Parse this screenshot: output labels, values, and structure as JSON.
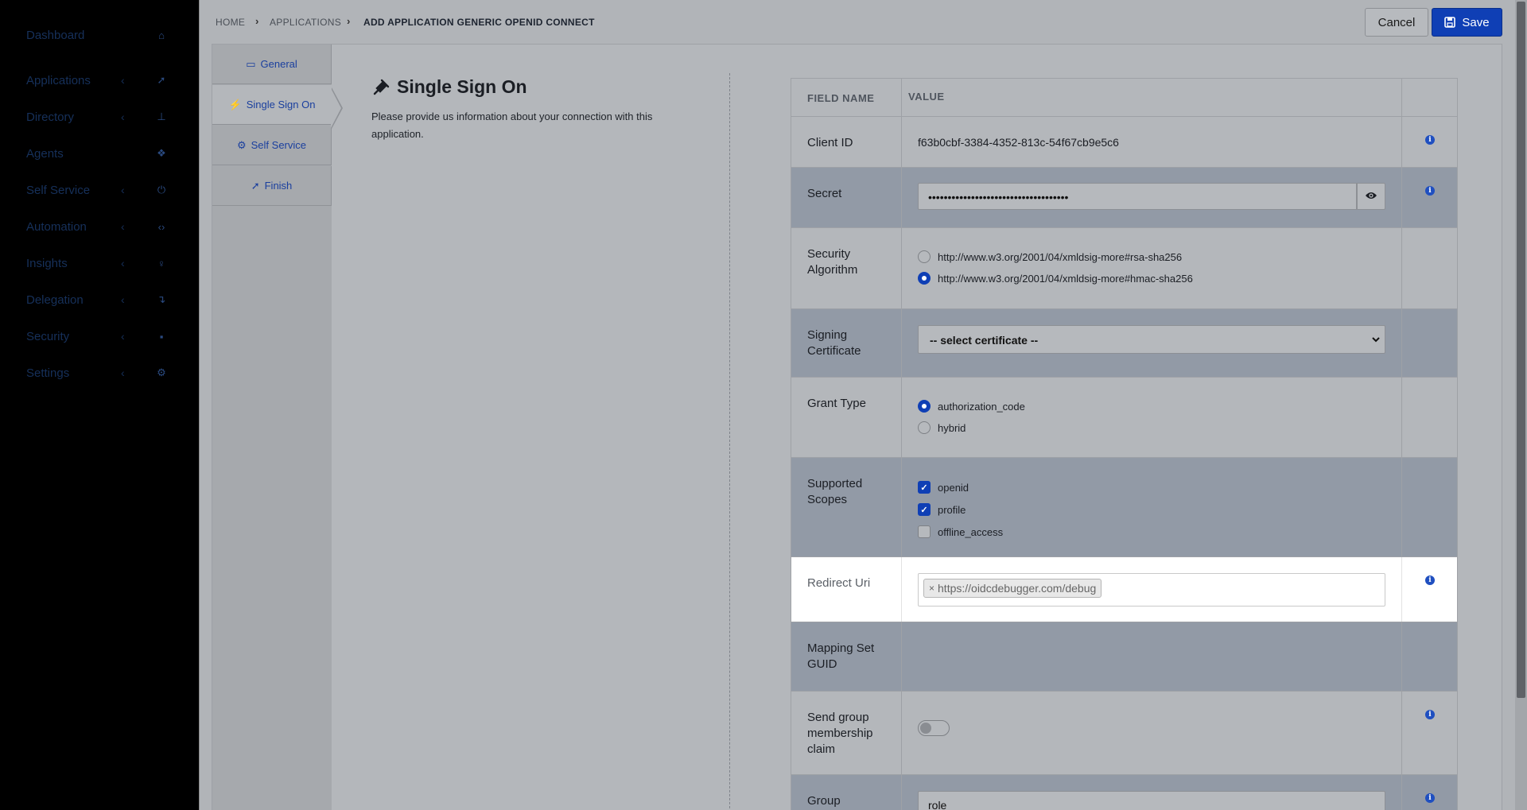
{
  "sidebar": {
    "items": [
      {
        "label": "Dashboard",
        "chevron": "",
        "icon": "home-icon",
        "glyph": "⌂"
      },
      {
        "label": "Applications",
        "chevron": "‹",
        "icon": "rocket-icon",
        "glyph": "➚"
      },
      {
        "label": "Directory",
        "chevron": "‹",
        "icon": "sitemap-icon",
        "glyph": "⊥"
      },
      {
        "label": "Agents",
        "chevron": "",
        "icon": "cubes-icon",
        "glyph": "❖"
      },
      {
        "label": "Self Service",
        "chevron": "‹",
        "icon": "power-icon",
        "glyph": "⏻"
      },
      {
        "label": "Automation",
        "chevron": "‹",
        "icon": "code-icon",
        "glyph": "‹›"
      },
      {
        "label": "Insights",
        "chevron": "‹",
        "icon": "lightbulb-icon",
        "glyph": "♀"
      },
      {
        "label": "Delegation",
        "chevron": "‹",
        "icon": "level-icon",
        "glyph": "↴"
      },
      {
        "label": "Security",
        "chevron": "‹",
        "icon": "lock-icon",
        "glyph": "▪"
      },
      {
        "label": "Settings",
        "chevron": "‹",
        "icon": "gear-icon",
        "glyph": "⚙"
      }
    ]
  },
  "breadcrumb": {
    "home": "HOME",
    "applications": "APPLICATIONS",
    "current": "ADD APPLICATION GENERIC OPENID CONNECT",
    "sep": "›"
  },
  "toolbar": {
    "cancel_label": "Cancel",
    "save_label": "Save"
  },
  "tabs": [
    {
      "label": "General",
      "icon": "desktop-icon",
      "glyph": "▭"
    },
    {
      "label": "Single Sign On",
      "icon": "plug-icon",
      "glyph": "⚡"
    },
    {
      "label": "Self Service",
      "icon": "cogs-icon",
      "glyph": "⚙"
    },
    {
      "label": "Finish",
      "icon": "rocket-icon",
      "glyph": "➚"
    }
  ],
  "section": {
    "title": "Single Sign On",
    "description": "Please provide us information about your connection with this application."
  },
  "table": {
    "header_field": "FIELD NAME",
    "header_value": "VALUE",
    "client_id": {
      "label": "Client ID",
      "value": "f63b0cbf-3384-4352-813c-54f67cb9e5c6"
    },
    "secret": {
      "label": "Secret",
      "value": "••••••••••••••••••••••••••••••••••••"
    },
    "security_algorithm": {
      "label": "Security Algorithm",
      "options": [
        {
          "label": "http://www.w3.org/2001/04/xmldsig-more#rsa-sha256",
          "selected": false
        },
        {
          "label": "http://www.w3.org/2001/04/xmldsig-more#hmac-sha256",
          "selected": true
        }
      ]
    },
    "signing_certificate": {
      "label": "Signing Certificate",
      "selected": "-- select certificate --"
    },
    "grant_type": {
      "label": "Grant Type",
      "options": [
        {
          "label": "authorization_code",
          "selected": true
        },
        {
          "label": "hybrid",
          "selected": false
        }
      ]
    },
    "supported_scopes": {
      "label": "Supported Scopes",
      "options": [
        {
          "label": "openid",
          "checked": true
        },
        {
          "label": "profile",
          "checked": true
        },
        {
          "label": "offline_access",
          "checked": false
        }
      ]
    },
    "redirect_uri": {
      "label": "Redirect Uri",
      "tag": "https://oidcdebugger.com/debug",
      "remove": "×"
    },
    "mapping_set_guid": {
      "label": "Mapping Set GUID"
    },
    "send_group_claim": {
      "label": "Send group membership claim",
      "enabled": false
    },
    "group": {
      "label": "Group",
      "value": "role"
    }
  },
  "colors": {
    "accent": "#0f3fb5",
    "alt_row": "#929aa6",
    "highlight_row": "#ffffff"
  }
}
